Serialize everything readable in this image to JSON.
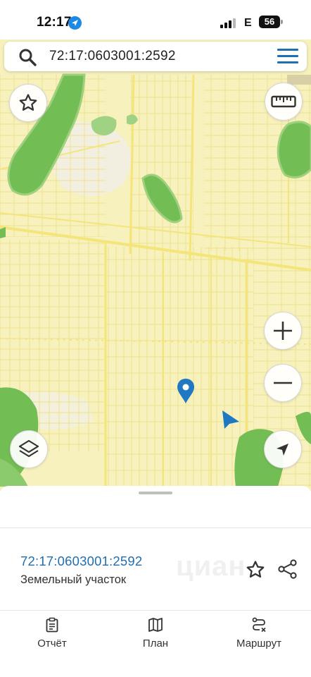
{
  "status_bar": {
    "time": "12:17",
    "network": "E",
    "battery": "56"
  },
  "search": {
    "query": "72:17:0603001:2592"
  },
  "map_controls": {
    "favorite": "star-icon",
    "ruler": "ruler-icon",
    "zoom_in": "plus-icon",
    "zoom_out": "minus-icon",
    "layers": "layers-icon",
    "locate": "navigation-arrow-icon"
  },
  "parcel": {
    "number": "72:17:0603001:2592",
    "type": "Земельный участок"
  },
  "watermark": "циан",
  "bottom_nav": [
    {
      "label": "Отчёт",
      "icon": "clipboard-icon"
    },
    {
      "label": "План",
      "icon": "map-icon"
    },
    {
      "label": "Маршрут",
      "icon": "route-icon"
    }
  ],
  "colors": {
    "accent": "#1f6fb2",
    "map_background": "#f5f0b9",
    "parcel_lines": "#eee084",
    "vegetation": "#7ac35b"
  }
}
